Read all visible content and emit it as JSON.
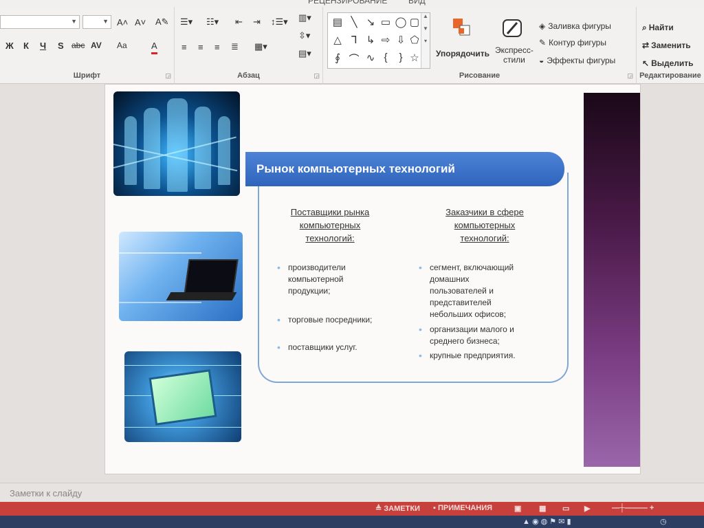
{
  "top_tabs": [
    "РЕЦЕНЗИРОВАНИЕ",
    "ВИД"
  ],
  "ribbon": {
    "font": {
      "label": "Шрифт",
      "font_name_value": "",
      "font_size_value": "",
      "grow_font": "A˄",
      "shrink_font": "A˅",
      "clear_format": "A✎",
      "bold": "Ж",
      "italic": "К",
      "underline": "Ч",
      "strikethrough": "S",
      "shadow": "abc",
      "char_spacing": "AV",
      "change_case": "Aa",
      "font_color": "A"
    },
    "paragraph": {
      "label": "Абзац"
    },
    "drawing": {
      "label": "Рисование",
      "arrange": "Упорядочить",
      "quick_styles_1": "Экспресс-",
      "quick_styles_2": "стили",
      "shape_fill": "Заливка фигуры",
      "shape_outline": "Контур фигуры",
      "shape_effects": "Эффекты фигуры"
    },
    "editing": {
      "label": "Редактирование",
      "find": "Найти",
      "replace": "Заменить",
      "select": "Выделить"
    }
  },
  "slide": {
    "title": "Рынок компьютерных технологий",
    "left_column": {
      "heading": [
        "Поставщики рынка",
        "компьютерных",
        "технологий:"
      ],
      "bullets": [
        [
          "производители",
          "компьютерной",
          "продукции;"
        ],
        [
          "торговые посредники;"
        ],
        [
          "поставщики услуг."
        ]
      ]
    },
    "right_column": {
      "heading": [
        "Заказчики в сфере",
        "компьютерных",
        "технологий:"
      ],
      "bullets": [
        [
          "сегмент, включающий",
          "домашних",
          "пользователей и",
          "представителей",
          "небольших офисов;"
        ],
        [
          "организации малого и",
          "среднего бизнеса;"
        ],
        [
          "крупные предприятия."
        ]
      ]
    }
  },
  "notes_placeholder": "Заметки к слайду",
  "statusbar": {
    "notes": "ЗАМЕТКИ",
    "comments": "ПРИМЕЧАНИЯ"
  },
  "colors": {
    "banner": "#3f74cc",
    "box_border": "#7fa6d8",
    "statusbar": "#c7403b",
    "side_bar_dark": "#1a0818",
    "side_bar_light": "#9a66aa"
  }
}
